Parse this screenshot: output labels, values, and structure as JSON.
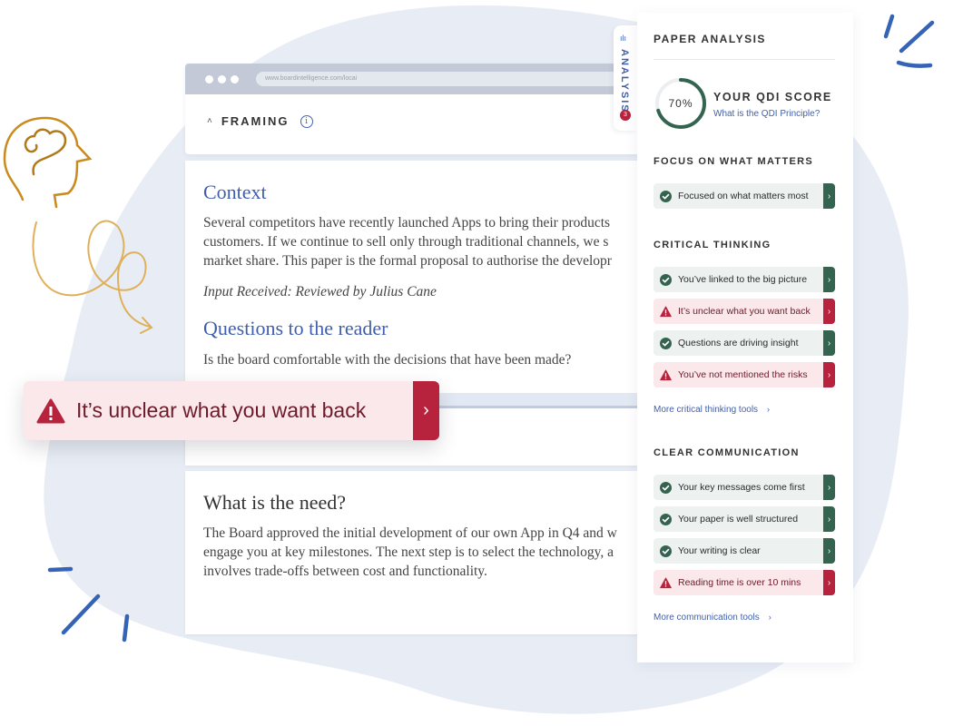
{
  "browser": {
    "url": "www.boardintelligence.com/locai",
    "section_label": "FRAMING",
    "caret_icon": "˄",
    "info_icon": "i"
  },
  "document": {
    "context_heading": "Context",
    "context_lines": [
      "Several competitors have recently launched Apps to bring their products",
      "customers. If we continue to sell only through traditional channels, we s",
      "market share. This paper is the formal proposal to authorise the developr"
    ],
    "input_note": "Input Received: Reviewed by Julius Cane",
    "questions_heading": "Questions to the reader",
    "question_line": "Is the board comfortable with the decisions that have been made?",
    "need_heading": "What is the need?",
    "need_lines": [
      "The Board approved the initial development of our own App in Q4 and w",
      "engage you at key milestones. The next step is to select the technology, a",
      "involves trade-offs between cost and functionality."
    ]
  },
  "alert": {
    "text": "It’s unclear what you want back",
    "chevron": "›"
  },
  "analysis_tab": {
    "label": "ANALYSIS",
    "badge_count": "3",
    "icon": "ılı"
  },
  "panel": {
    "title": "PAPER ANALYSIS",
    "score": {
      "value_label": "70%",
      "value": 0.7,
      "title": "YOUR QDI SCORE",
      "link": "What is the QDI Principle?"
    },
    "sections": [
      {
        "title": "FOCUS ON WHAT MATTERS",
        "items": [
          {
            "label": "Focused on what matters most",
            "status": "ok"
          }
        ]
      },
      {
        "title": "CRITICAL THINKING",
        "items": [
          {
            "label": "You’ve linked to the big picture",
            "status": "ok"
          },
          {
            "label": "It’s unclear what you want back",
            "status": "warning"
          },
          {
            "label": "Questions are driving insight",
            "status": "ok"
          },
          {
            "label": "You’ve not mentioned the risks",
            "status": "warning"
          }
        ],
        "more_link": "More critical thinking tools"
      },
      {
        "title": "CLEAR COMMUNICATION",
        "items": [
          {
            "label": "Your key messages come first",
            "status": "ok"
          },
          {
            "label": "Your paper is well structured",
            "status": "ok"
          },
          {
            "label": "Your writing is clear",
            "status": "ok"
          },
          {
            "label": "Reading time is over 10 mins",
            "status": "warning"
          }
        ],
        "more_link": "More communication tools"
      }
    ],
    "chevron": "›"
  },
  "colors": {
    "accent_blue": "#3f5fae",
    "ok_green": "#34644f",
    "warning_red": "#b7223c",
    "doodle_gold": "#d9a441",
    "doodle_blue": "#3563b5",
    "background_blob": "#e8edf5"
  }
}
